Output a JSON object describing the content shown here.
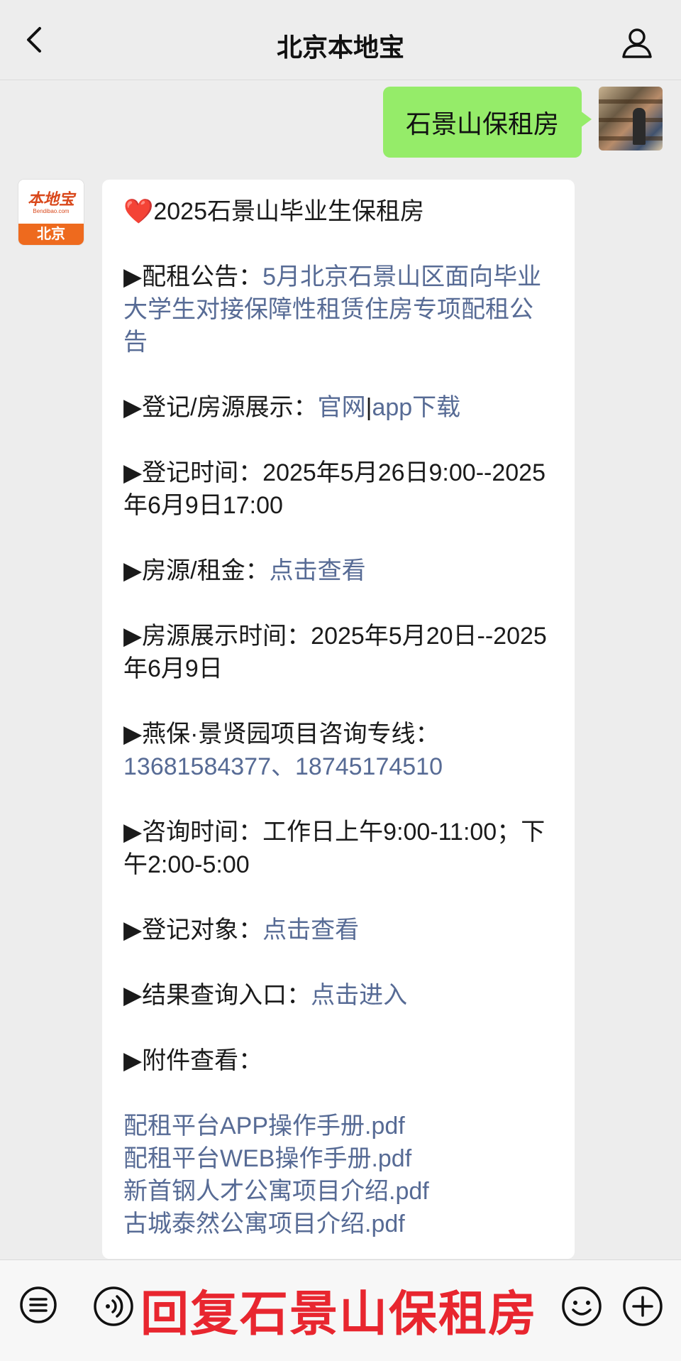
{
  "header": {
    "title": "北京本地宝"
  },
  "outgoing": {
    "text": "石景山保租房"
  },
  "bot_avatar": {
    "brand": "本地宝",
    "domain": "Bendibao.com",
    "city": "北京"
  },
  "message": {
    "heart": "❤️",
    "title": "2025石景山毕业生保租房",
    "items": {
      "notice": {
        "label": "▶配租公告：",
        "link": "5月北京石景山区面向毕业大学生对接保障性租赁住房专项配租公告"
      },
      "register": {
        "label": "▶登记/房源展示：",
        "link1": "官网",
        "sep": "|",
        "link2": "app下载"
      },
      "reg_time": {
        "label": "▶登记时间：",
        "value": "2025年5月26日9:00--2025年6月9日17:00"
      },
      "rent": {
        "label": "▶房源/租金：",
        "link": "点击查看"
      },
      "show_time": {
        "label": "▶房源展示时间：",
        "value": "2025年5月20日--2025年6月9日"
      },
      "hotline": {
        "label": "▶燕保·景贤园项目咨询专线：",
        "link": "13681584377、18745174510"
      },
      "consult_time": {
        "label": "▶咨询时间：",
        "value": "工作日上午9:00-11:00；下午2:00-5:00"
      },
      "target": {
        "label": "▶登记对象：",
        "link": "点击查看"
      },
      "result": {
        "label": "▶结果查询入口：",
        "link": "点击进入"
      },
      "attachments": {
        "label": "▶附件查看：",
        "files": [
          "配租平台APP操作手册.pdf",
          "配租平台WEB操作手册.pdf",
          "新首钢人才公寓项目介绍.pdf",
          "古城泰然公寓项目介绍.pdf"
        ]
      }
    }
  },
  "bottombar": {
    "overlay_text": "回复石景山保租房"
  }
}
